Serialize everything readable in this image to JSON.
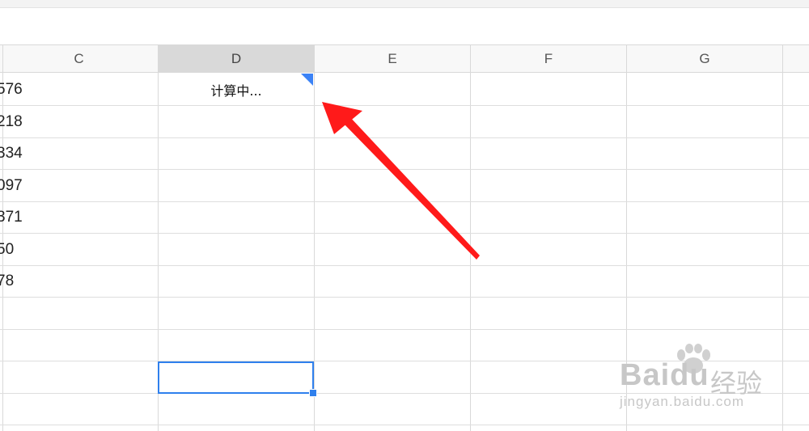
{
  "columns": [
    {
      "letter": "C",
      "active": false
    },
    {
      "letter": "D",
      "active": true
    },
    {
      "letter": "E",
      "active": false
    },
    {
      "letter": "F",
      "active": false
    },
    {
      "letter": "G",
      "active": false
    }
  ],
  "rows": [
    {
      "c": "576",
      "d": "计算中..."
    },
    {
      "c": "218",
      "d": ""
    },
    {
      "c": "334",
      "d": ""
    },
    {
      "c": "097",
      "d": ""
    },
    {
      "c": "371",
      "d": ""
    },
    {
      "c": "50",
      "d": ""
    },
    {
      "c": "78",
      "d": ""
    },
    {
      "c": "",
      "d": ""
    },
    {
      "c": "",
      "d": ""
    },
    {
      "c": "",
      "d": ""
    },
    {
      "c": "",
      "d": ""
    }
  ],
  "colors": {
    "selection": "#2f80ed",
    "annotation_arrow": "#ff1a1a",
    "flag": "#3b82f6"
  },
  "watermark": {
    "brand": "Bai",
    "brand2": "du",
    "cn": "经验",
    "url": "jingyan.baidu.com"
  }
}
